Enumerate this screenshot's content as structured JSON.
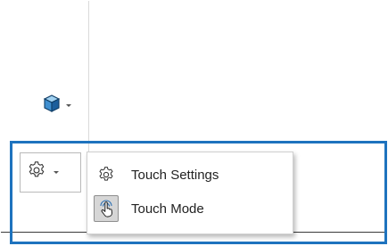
{
  "toolbar": {
    "view_button": {
      "icon": "cube-icon",
      "menu_indicator": "chevron-down-icon"
    },
    "touch_button": {
      "icon": "gear-icon",
      "menu_indicator": "chevron-down-icon"
    }
  },
  "dropdown_menu": {
    "items": [
      {
        "label": "Touch Settings",
        "icon": "gear-icon",
        "active": false
      },
      {
        "label": "Touch Mode",
        "icon": "hand-touch-icon",
        "active": true
      }
    ]
  },
  "colors": {
    "highlight": "#1e73be",
    "cube_front": "#3f8fd0",
    "cube_top": "#9fd0f0",
    "cube_side": "#1d5f9c",
    "active_item_bg": "#d6d6d6"
  }
}
